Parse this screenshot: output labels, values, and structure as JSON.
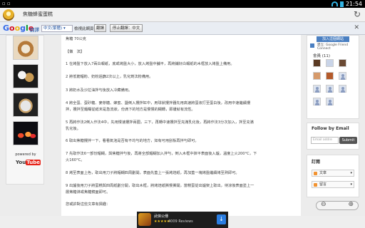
{
  "status_bar": {
    "notif_glyph": "▫ ▫",
    "time": "21:54"
  },
  "app_header": {
    "title": "焦糖蜂蜜蛋糕",
    "refresh_icon": "↻"
  },
  "translate_bar": {
    "google_letters": [
      "G",
      "o",
      "o",
      "g",
      "l",
      "e"
    ],
    "translate_label": "翻譯",
    "language": "中文(繁體) ▾",
    "view_label": "檢視此網頁",
    "translate_button": "翻譯",
    "stop_button": "停止翻譯：中文",
    "close_icon": "✕"
  },
  "left_sidebar": {
    "powered_by": "powered by",
    "youtube_you": "You",
    "youtube_tube": "Tube"
  },
  "article": {
    "lines": [
      "焦糖 70公克",
      "【做　法】",
      "1 在烤盤下放入7兩白報紙，底或烤盤大小，放入烤盤中舖平，再將鋪好白報紙的木框放入烤盤上備用。",
      "2 將低筋麵粉、奶粉過篩2次以上，乳化劑法粉備用。",
      "3 將奶水及沙拉油拌勻後放入冷藏備用。",
      "4 將全蛋、蛋砂糖、麥芽糖、蜂蜜、鹽倒入攪拌缸中，用球狀攪拌器先用高速將蛋液打至蛋白後，改用中速繼續攪",
      "拌，攪拌至麵糊從紙末是急流狀，份滴下的地方是慢慢的糊轉，即緩就有流性。",
      "5 再將作法2倒入作法4中，先用慢速攪拌兩圈，三下，再轉中速攪拌至充滿乳化後，再將作法3分次加入，拌至充滿",
      "乳化後。",
      "6 取出焦糖攪拌一下，看看氣泡是否有不均勻的地方，如有可用刮板再拌勻即可。",
      "7 先取作法6一部份麵糊，與焦糖拌勻後，再將全部麵糊加入拌勻，倒入木框中抹平表面後入爐，溫度上火200°C，下",
      "火160°C。",
      "8 烤至表面上色，取出用刀子將麵糊四周劃開，表面先蓋上一張烤焙紙，再加蓋一塊烤盤繼續烤至熟即可。",
      "9 出爐後用刀子將蛋糕與四周紙劃分開，取出木框，將烤焙紙撕慢撕開，當糕蛋從出爐架上取出，待涼後表面塗上一",
      "層焦糖淋或焦糖鏡面即可。",
      "您或許對這些文章有興趣："
    ]
  },
  "right_sidebar": {
    "join_button": "加入這個網站",
    "gfc_line1": "建立: Google Friend",
    "gfc_line2": "Connect",
    "members_label": "會員 (11)",
    "follow_title": "Follow by Email",
    "email_placeholder": "Email addre",
    "submit_label": "Submit",
    "subscribe_title": "訂閱",
    "feed_posts": "文章",
    "feed_comments": "留言"
  },
  "zoom": {
    "minus": "⊖",
    "plus": "⊕"
  },
  "ad": {
    "title": "武俠公傳",
    "stars": "★★★★★",
    "reviews": "4009 Reviews",
    "download_icon": "↓"
  }
}
